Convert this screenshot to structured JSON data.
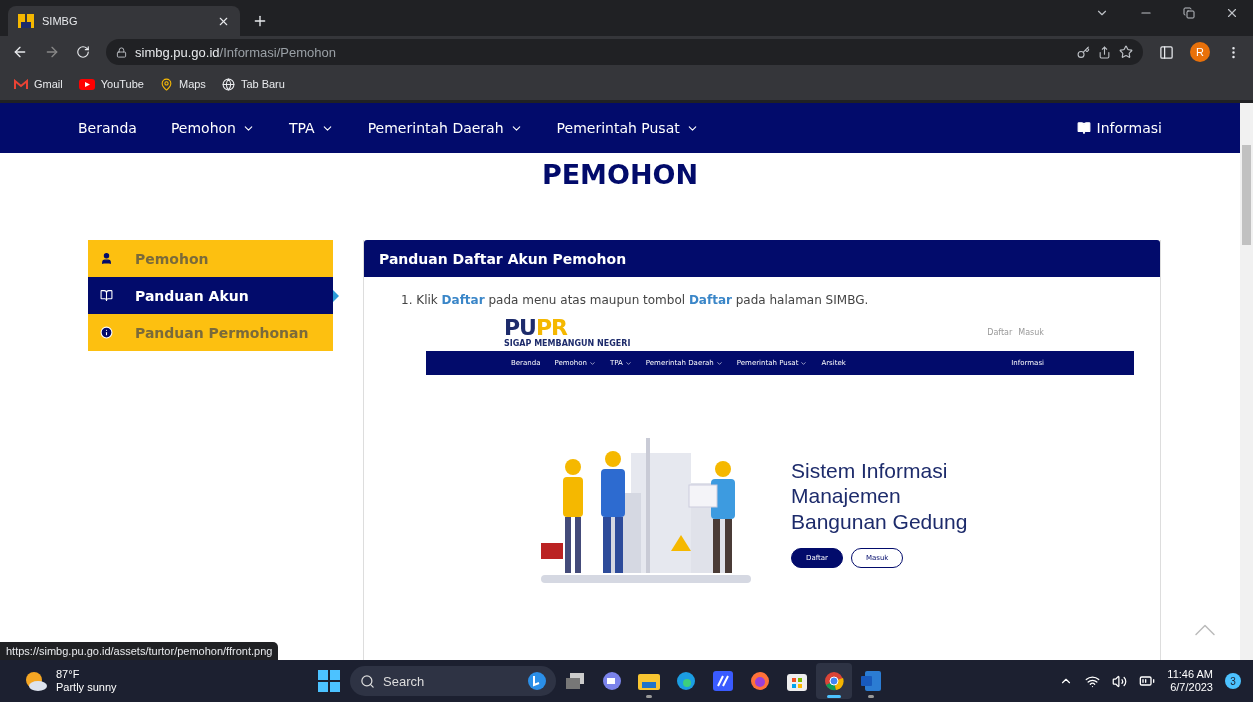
{
  "browser": {
    "tab_title": "SIMBG",
    "url_host": "simbg.pu.go.id",
    "url_path": "/Informasi/Pemohon",
    "profile_initial": "R",
    "bookmarks": [
      {
        "kind": "mail",
        "label": "Gmail"
      },
      {
        "kind": "video",
        "label": "YouTube"
      },
      {
        "kind": "pin",
        "label": "Maps"
      },
      {
        "kind": "globe",
        "label": "Tab Baru"
      }
    ]
  },
  "site_nav": {
    "items": [
      {
        "label": "Beranda",
        "dropdown": false
      },
      {
        "label": "Pemohon",
        "dropdown": true
      },
      {
        "label": "TPA",
        "dropdown": true
      },
      {
        "label": "Pemerintah Daerah",
        "dropdown": true
      },
      {
        "label": "Pemerintah Pusat",
        "dropdown": true
      }
    ],
    "info_link": "Informasi"
  },
  "page_title": "PEMOHON",
  "sidebar": {
    "items": [
      {
        "kind": "user",
        "label": "Pemohon",
        "selected": false
      },
      {
        "kind": "book",
        "label": "Panduan Akun",
        "selected": true
      },
      {
        "kind": "info",
        "label": "Panduan Permohonan",
        "selected": false
      }
    ]
  },
  "card": {
    "title": "Panduan Daftar Akun Pemohon",
    "steps": [
      {
        "number": "1.",
        "text": "Klik **Daftar** pada menu atas maupun tombol **Daftar** pada halaman SIMBG."
      }
    ],
    "screenshot": {
      "logo_left": "PU",
      "logo_right": "PR",
      "tagline": "SIGAP MEMBANGUN NEGERI",
      "auth_links": [
        "Daftar",
        "Masuk"
      ],
      "nav_items": [
        {
          "label": "Beranda",
          "dropdown": false
        },
        {
          "label": "Pemohon",
          "dropdown": true
        },
        {
          "label": "TPA",
          "dropdown": true
        },
        {
          "label": "Pemerintah Daerah",
          "dropdown": true
        },
        {
          "label": "Pemerintah Pusat",
          "dropdown": true
        },
        {
          "label": "Arsitek",
          "dropdown": false
        }
      ],
      "info_link": "Informasi",
      "hero_lines": [
        "Sistem Informasi",
        "Manajemen",
        "Bangunan Gedung"
      ],
      "buttons": [
        {
          "label": "Daftar",
          "primary": true
        },
        {
          "label": "Masuk",
          "primary": false
        }
      ]
    }
  },
  "status_url": "https://simbg.pu.go.id/assets/turtor/pemohon/ffront.png",
  "taskbar": {
    "weather_temp": "87°F",
    "weather_text": "Partly sunny",
    "search_placeholder": "Search",
    "apps": [
      {
        "kind": "taskview",
        "selected": false,
        "running": false
      },
      {
        "kind": "chat",
        "selected": false,
        "running": false
      },
      {
        "kind": "folder",
        "selected": false,
        "running": true
      },
      {
        "kind": "edge",
        "selected": false,
        "running": false
      },
      {
        "kind": "editor",
        "selected": false,
        "running": false
      },
      {
        "kind": "firefox",
        "selected": false,
        "running": false
      },
      {
        "kind": "store",
        "selected": false,
        "running": false
      },
      {
        "kind": "chrome",
        "selected": true,
        "running": true
      },
      {
        "kind": "word",
        "selected": false,
        "running": true
      }
    ],
    "time": "11:46 AM",
    "date": "6/7/2023",
    "notifications": "3"
  }
}
